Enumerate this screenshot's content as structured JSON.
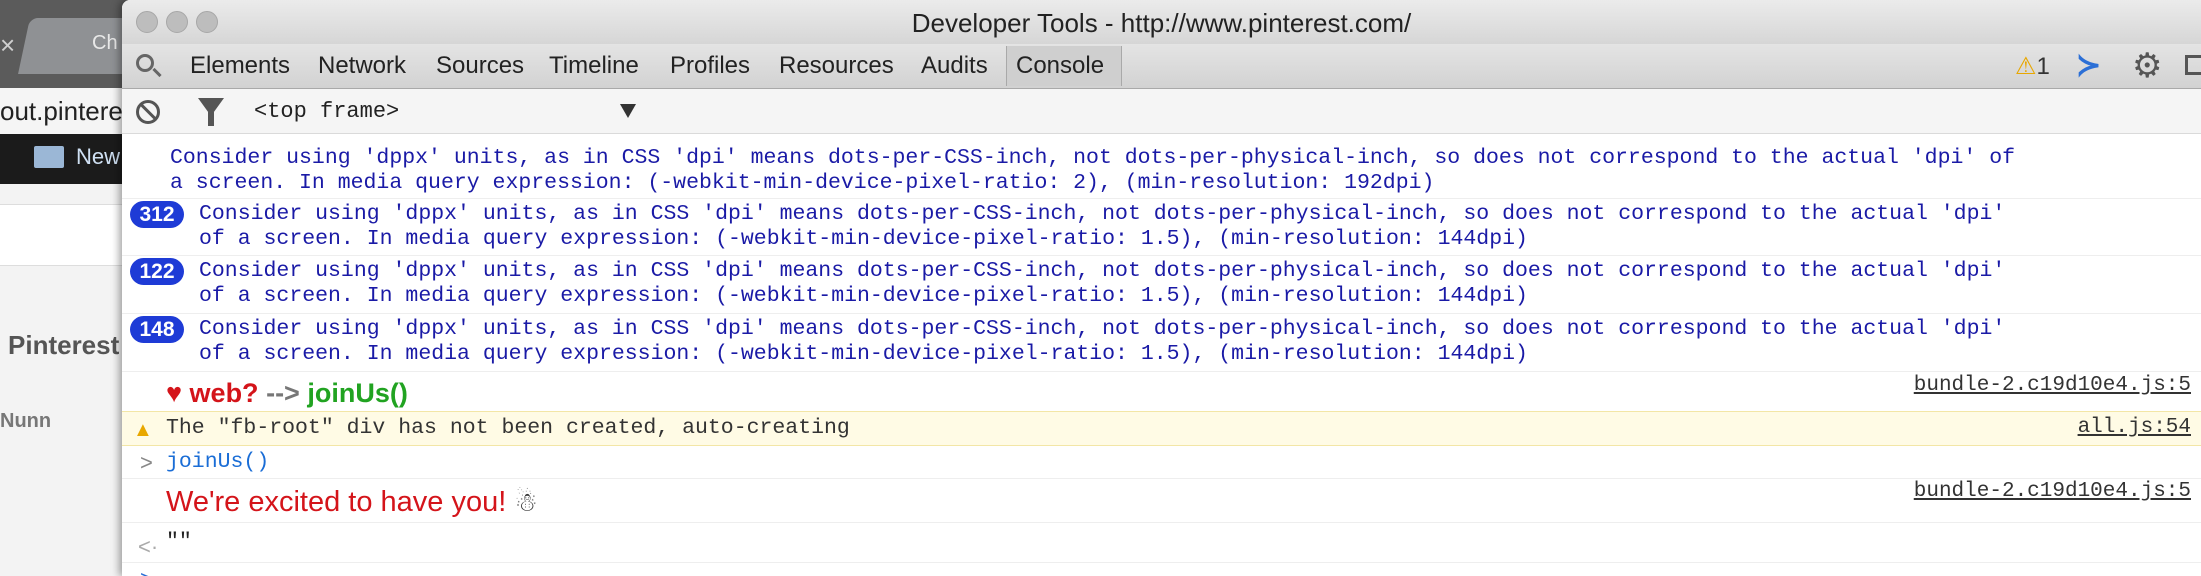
{
  "background_browser": {
    "tab_text": "Ch",
    "url_text": "out.pintere",
    "bookmark_text": "New",
    "page_heading": "Pinterest",
    "page_text": "Nunn"
  },
  "window": {
    "title": "Developer Tools - http://www.pinterest.com/"
  },
  "toolbar": {
    "tabs": [
      "Elements",
      "Network",
      "Sources",
      "Timeline",
      "Profiles",
      "Resources",
      "Audits",
      "Console"
    ],
    "active_tab": "Console",
    "warning_count": "1"
  },
  "filterbar": {
    "frame": "<top frame>"
  },
  "console": {
    "messages": [
      {
        "line1": "Consider using 'dppx' units, as in CSS 'dpi' means dots-per-CSS-inch, not dots-per-physical-inch, so does not correspond to the actual 'dpi' of",
        "line2": "a screen. In media query expression: (-webkit-min-device-pixel-ratio: 2), (min-resolution: 192dpi)"
      },
      {
        "count": "312",
        "line1": "Consider using 'dppx' units, as in CSS 'dpi' means dots-per-CSS-inch, not dots-per-physical-inch, so does not correspond to the actual 'dpi'",
        "line2": "of a screen. In media query expression: (-webkit-min-device-pixel-ratio: 1.5), (min-resolution: 144dpi)"
      },
      {
        "count": "122",
        "line1": "Consider using 'dppx' units, as in CSS 'dpi' means dots-per-CSS-inch, not dots-per-physical-inch, so does not correspond to the actual 'dpi'",
        "line2": "of a screen. In media query expression: (-webkit-min-device-pixel-ratio: 1.5), (min-resolution: 144dpi)"
      },
      {
        "count": "148",
        "line1": "Consider using 'dppx' units, as in CSS 'dpi' means dots-per-CSS-inch, not dots-per-physical-inch, so does not correspond to the actual 'dpi'",
        "line2": "of a screen. In media query expression: (-webkit-min-device-pixel-ratio: 1.5), (min-resolution: 144dpi)"
      }
    ],
    "styled_log": {
      "heart": "♥",
      "part1": "web?",
      "arrow": "-->",
      "part2": "joinUs()",
      "source": "bundle-2.c19d10e4.js:5"
    },
    "warning": {
      "text": "The \"fb-root\" div has not been created, auto-creating",
      "source": "all.js:54"
    },
    "command": "joinUs()",
    "excited": {
      "text": "We're excited to have you!",
      "emoji": "☃",
      "source": "bundle-2.c19d10e4.js:5"
    },
    "result": "\"\""
  }
}
